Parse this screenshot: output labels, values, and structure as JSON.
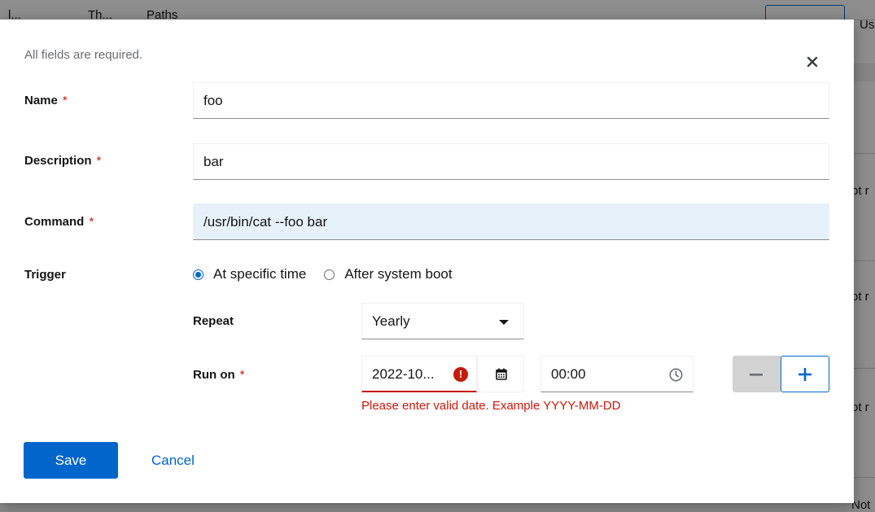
{
  "background": {
    "header_tabs": [
      "l...",
      "Th...",
      "Paths"
    ],
    "header_us": "Us",
    "row_snippets": [
      "ot r",
      "ot r",
      "ot r",
      "Not"
    ]
  },
  "dialog": {
    "hint": "All fields are required.",
    "close_icon": "close-icon",
    "required_mark": "*",
    "name": {
      "label": "Name",
      "value": "foo"
    },
    "description": {
      "label": "Description",
      "value": "bar"
    },
    "command": {
      "label": "Command",
      "value": "/usr/bin/cat --foo bar"
    },
    "trigger": {
      "label": "Trigger",
      "options": [
        "At specific time",
        "After system boot"
      ],
      "selected": "At specific time"
    },
    "repeat": {
      "label": "Repeat",
      "value": "Yearly"
    },
    "run_on": {
      "label": "Run on",
      "date_value": "2022-10...",
      "time_value": "00:00",
      "error": "Please enter valid date. Example YYYY-MM-DD"
    },
    "save_label": "Save",
    "cancel_label": "Cancel"
  },
  "colors": {
    "primary": "#0066cc",
    "danger": "#c9190b",
    "text": "#151515",
    "muted": "#6a6e73"
  }
}
